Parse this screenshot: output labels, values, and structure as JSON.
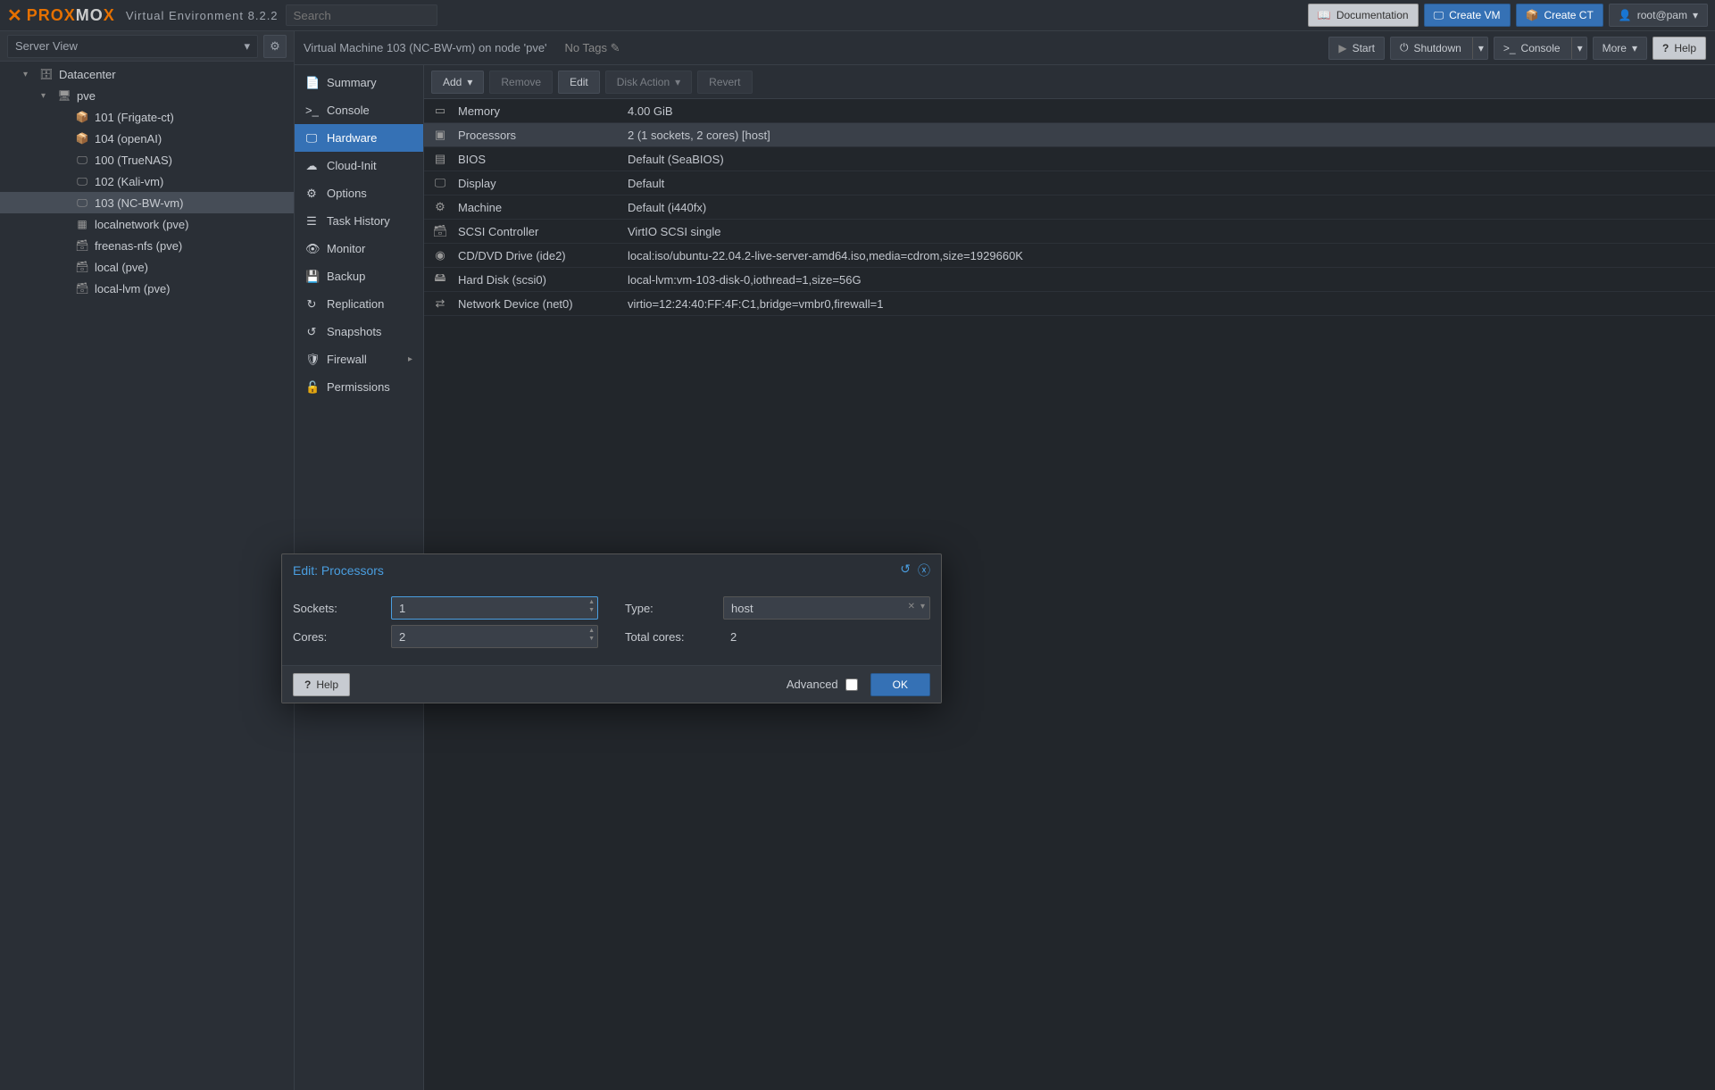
{
  "header": {
    "logo_orange": "PRO",
    "logo_grey": "MO",
    "logo_x": "X",
    "env_label": "Virtual Environment 8.2.2",
    "search_placeholder": "Search",
    "doc_label": "Documentation",
    "create_vm_label": "Create VM",
    "create_ct_label": "Create CT",
    "user_label": "root@pam"
  },
  "sidebar": {
    "view_label": "Server View",
    "tree": [
      {
        "label": "Datacenter",
        "indent": 1,
        "icon": "server-icon",
        "arrow": true
      },
      {
        "label": "pve",
        "indent": 2,
        "icon": "node-icon",
        "arrow": true
      },
      {
        "label": "101 (Frigate-ct)",
        "indent": 3,
        "icon": "ct-icon"
      },
      {
        "label": "104 (openAI)",
        "indent": 3,
        "icon": "ct-icon"
      },
      {
        "label": "100 (TrueNAS)",
        "indent": 3,
        "icon": "vm-icon"
      },
      {
        "label": "102 (Kali-vm)",
        "indent": 3,
        "icon": "vm-icon"
      },
      {
        "label": "103 (NC-BW-vm)",
        "indent": 3,
        "icon": "vm-icon",
        "selected": true
      },
      {
        "label": "localnetwork (pve)",
        "indent": 3,
        "icon": "network-icon"
      },
      {
        "label": "freenas-nfs (pve)",
        "indent": 3,
        "icon": "storage-icon"
      },
      {
        "label": "local (pve)",
        "indent": 3,
        "icon": "storage-icon"
      },
      {
        "label": "local-lvm (pve)",
        "indent": 3,
        "icon": "storage-icon"
      }
    ]
  },
  "content_header": {
    "breadcrumb": "Virtual Machine 103 (NC-BW-vm) on node 'pve'",
    "notags": "No Tags",
    "start": "Start",
    "shutdown": "Shutdown",
    "console": "Console",
    "more": "More",
    "help": "Help"
  },
  "subnav": [
    {
      "label": "Summary",
      "icon": "summary-icon"
    },
    {
      "label": "Console",
      "icon": "console-icon"
    },
    {
      "label": "Hardware",
      "icon": "hardware-icon",
      "active": true
    },
    {
      "label": "Cloud-Init",
      "icon": "cloud-icon"
    },
    {
      "label": "Options",
      "icon": "gear-icon"
    },
    {
      "label": "Task History",
      "icon": "task-icon"
    },
    {
      "label": "Monitor",
      "icon": "monitor-icon"
    },
    {
      "label": "Backup",
      "icon": "backup-icon"
    },
    {
      "label": "Replication",
      "icon": "replication-icon"
    },
    {
      "label": "Snapshots",
      "icon": "snapshot-icon"
    },
    {
      "label": "Firewall",
      "icon": "firewall-icon",
      "chevron": true
    },
    {
      "label": "Permissions",
      "icon": "permissions-icon"
    }
  ],
  "toolbar": {
    "add": "Add",
    "remove": "Remove",
    "edit": "Edit",
    "disk_action": "Disk Action",
    "revert": "Revert"
  },
  "hardware_rows": [
    {
      "icon": "memory-icon",
      "label": "Memory",
      "value": "4.00 GiB"
    },
    {
      "icon": "cpu-icon",
      "label": "Processors",
      "value": "2 (1 sockets, 2 cores) [host]",
      "selected": true
    },
    {
      "icon": "bios-icon",
      "label": "BIOS",
      "value": "Default (SeaBIOS)"
    },
    {
      "icon": "display-icon",
      "label": "Display",
      "value": "Default"
    },
    {
      "icon": "machine-icon",
      "label": "Machine",
      "value": "Default (i440fx)"
    },
    {
      "icon": "scsi-icon",
      "label": "SCSI Controller",
      "value": "VirtIO SCSI single"
    },
    {
      "icon": "cd-icon",
      "label": "CD/DVD Drive (ide2)",
      "value": "local:iso/ubuntu-22.04.2-live-server-amd64.iso,media=cdrom,size=1929660K"
    },
    {
      "icon": "hdd-icon",
      "label": "Hard Disk (scsi0)",
      "value": "local-lvm:vm-103-disk-0,iothread=1,size=56G"
    },
    {
      "icon": "net-icon",
      "label": "Network Device (net0)",
      "value": "virtio=12:24:40:FF:4F:C1,bridge=vmbr0,firewall=1"
    }
  ],
  "modal": {
    "title": "Edit: Processors",
    "sockets_label": "Sockets:",
    "sockets_value": "1",
    "cores_label": "Cores:",
    "cores_value": "2",
    "type_label": "Type:",
    "type_value": "host",
    "total_label": "Total cores:",
    "total_value": "2",
    "help": "Help",
    "advanced": "Advanced",
    "ok": "OK"
  },
  "icons": {
    "server-icon": "🗄",
    "node-icon": "🖥",
    "ct-icon": "📦",
    "vm-icon": "🖵",
    "network-icon": "▦",
    "storage-icon": "🗃",
    "summary-icon": "📄",
    "console-icon": ">_",
    "hardware-icon": "🖵",
    "cloud-icon": "☁",
    "gear-icon": "⚙",
    "task-icon": "☰",
    "monitor-icon": "👁",
    "backup-icon": "💾",
    "replication-icon": "↻",
    "snapshot-icon": "↺",
    "firewall-icon": "🛡",
    "permissions-icon": "🔓",
    "memory-icon": "▭",
    "cpu-icon": "▣",
    "bios-icon": "▤",
    "display-icon": "🖵",
    "machine-icon": "⚙",
    "scsi-icon": "🗃",
    "cd-icon": "◉",
    "hdd-icon": "🖴",
    "net-icon": "⇄",
    "book-icon": "📖",
    "user-icon": "👤",
    "help-icon": "?",
    "play-icon": "▶",
    "power-icon": "⏻",
    "terminal-icon": ">_",
    "edit-icon": "✎",
    "chevron-down-icon": "▾",
    "reset-icon": "↺",
    "close-icon": "ⓧ"
  }
}
